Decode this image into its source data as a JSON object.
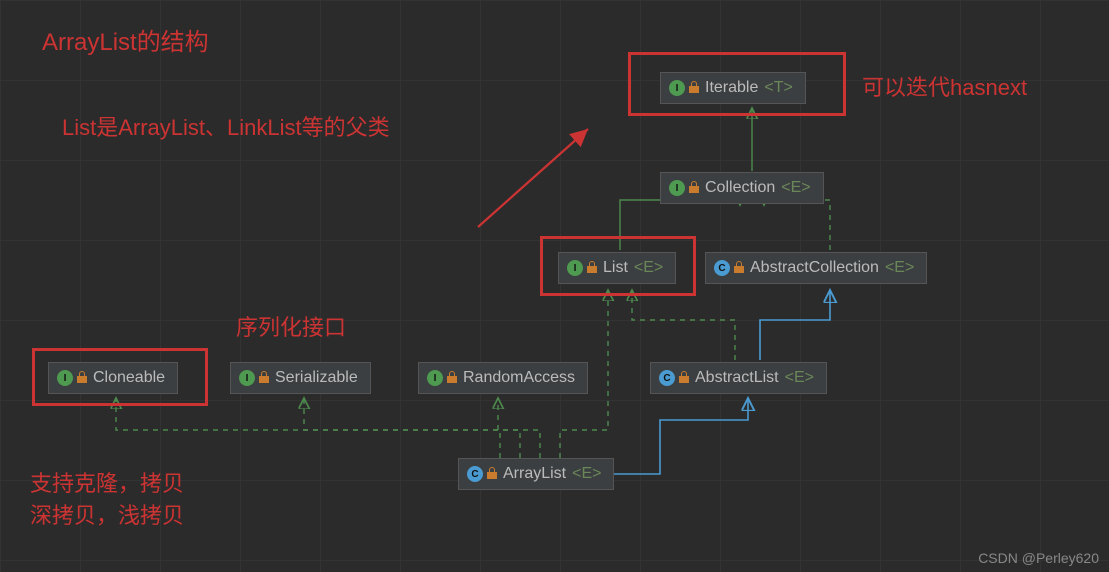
{
  "title": "ArrayList的结构",
  "annotations": {
    "iterable": "可以迭代hasnext",
    "list_parent": "List是ArrayList、LinkList等的父类",
    "serializable": "序列化接口",
    "cloneable_l1": "支持克隆，拷贝",
    "cloneable_l2": "深拷贝，浅拷贝"
  },
  "nodes": {
    "iterable": {
      "name": "Iterable",
      "generic": "<T>",
      "kind": "I"
    },
    "collection": {
      "name": "Collection",
      "generic": "<E>",
      "kind": "I"
    },
    "list": {
      "name": "List",
      "generic": "<E>",
      "kind": "I"
    },
    "abscoll": {
      "name": "AbstractCollection",
      "generic": "<E>",
      "kind": "C"
    },
    "abslist": {
      "name": "AbstractList",
      "generic": "<E>",
      "kind": "C"
    },
    "cloneable": {
      "name": "Cloneable",
      "generic": "",
      "kind": "I"
    },
    "serializable": {
      "name": "Serializable",
      "generic": "",
      "kind": "I"
    },
    "randomaccess": {
      "name": "RandomAccess",
      "generic": "",
      "kind": "I"
    },
    "arraylist": {
      "name": "ArrayList",
      "generic": "<E>",
      "kind": "C"
    }
  },
  "watermark": "CSDN @Perley620",
  "colors": {
    "bg": "#2b2b2b",
    "node_bg": "#3c3f41",
    "text": "#bbbbbb",
    "generic": "#6a8759",
    "annotation": "#cc3333",
    "extends_line": "#4a9bd1",
    "implements_line": "#4e8a4e"
  },
  "chart_data": {
    "type": "diagram",
    "title": "ArrayList class hierarchy",
    "nodes": [
      {
        "id": "Iterable<T>",
        "kind": "interface"
      },
      {
        "id": "Collection<E>",
        "kind": "interface"
      },
      {
        "id": "List<E>",
        "kind": "interface"
      },
      {
        "id": "AbstractCollection<E>",
        "kind": "abstract-class"
      },
      {
        "id": "AbstractList<E>",
        "kind": "abstract-class"
      },
      {
        "id": "Cloneable",
        "kind": "interface"
      },
      {
        "id": "Serializable",
        "kind": "interface"
      },
      {
        "id": "RandomAccess",
        "kind": "interface"
      },
      {
        "id": "ArrayList<E>",
        "kind": "class"
      }
    ],
    "edges": [
      {
        "from": "Collection<E>",
        "to": "Iterable<T>",
        "rel": "extends"
      },
      {
        "from": "List<E>",
        "to": "Collection<E>",
        "rel": "extends"
      },
      {
        "from": "AbstractCollection<E>",
        "to": "Collection<E>",
        "rel": "implements"
      },
      {
        "from": "AbstractList<E>",
        "to": "List<E>",
        "rel": "implements"
      },
      {
        "from": "AbstractList<E>",
        "to": "AbstractCollection<E>",
        "rel": "extends"
      },
      {
        "from": "ArrayList<E>",
        "to": "AbstractList<E>",
        "rel": "extends"
      },
      {
        "from": "ArrayList<E>",
        "to": "List<E>",
        "rel": "implements"
      },
      {
        "from": "ArrayList<E>",
        "to": "Cloneable",
        "rel": "implements"
      },
      {
        "from": "ArrayList<E>",
        "to": "Serializable",
        "rel": "implements"
      },
      {
        "from": "ArrayList<E>",
        "to": "RandomAccess",
        "rel": "implements"
      }
    ]
  }
}
